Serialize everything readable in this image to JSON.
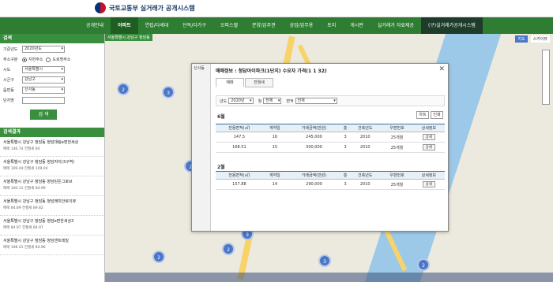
{
  "header": {
    "logo_text": "국토교통부 실거래가 공개시스템"
  },
  "nav": {
    "items": [
      {
        "label": "공개안내",
        "active": false
      },
      {
        "label": "아파트",
        "active": true
      },
      {
        "label": "연립/다세대",
        "active": false
      },
      {
        "label": "단독/다가구",
        "active": false
      },
      {
        "label": "오피스텔",
        "active": false
      },
      {
        "label": "분양/입주권",
        "active": false
      },
      {
        "label": "상업/업무용",
        "active": false
      },
      {
        "label": "토지",
        "active": false
      },
      {
        "label": "게시판",
        "active": false
      },
      {
        "label": "실거래가 자료제공",
        "active": false
      },
      {
        "label": "(구)실거래가공개시스템",
        "active": false
      }
    ]
  },
  "sidebar": {
    "search_title": "검색",
    "fields": {
      "period_label": "기준년도",
      "period_value": "2020년도",
      "type_label": "주소구분",
      "radio1": "지번주소",
      "radio2": "도로명주소",
      "city_label": "시도",
      "city_value": "서울특별시",
      "gu_label": "시군구",
      "gu_value": "강남구",
      "dong_label": "읍면동",
      "dong_value": "신사동",
      "name_label": "단지명"
    },
    "search_button": "검 색",
    "results_title": "검색결과",
    "results": [
      {
        "title": "서울특별시 강남구 청담동 청담대림e편한세상",
        "sub": "매매 146.74 전월세 84"
      },
      {
        "title": "서울특별시 강남구 청담동 청담자이(3구역)",
        "sub": "매매 109.44 전월세 109.04"
      },
      {
        "title": "서울특별시 강남구 청담동 청담린든그로브",
        "sub": "매매 100.11 전월세 84.99"
      },
      {
        "title": "서울특별시 강남구 청담동 청담래미안로이뷰",
        "sub": "매매 84.89 전월세 89.82"
      },
      {
        "title": "서울특별시 강남구 청담동 청담e편한세상3",
        "sub": "매매 84.97 전월세 84.97"
      },
      {
        "title": "서울특별시 강남구 청담동 청담센트레빌",
        "sub": "매매 108.41 전월세 84.96"
      }
    ]
  },
  "map": {
    "location_label": "서울특별시 강남구 청담동",
    "btn_map": "지도",
    "btn_sky": "스카이뷰",
    "clusters": [
      "2",
      "3",
      "2",
      "3",
      "2",
      "3",
      "2",
      "2"
    ]
  },
  "popup": {
    "side_label": "신사동",
    "title": "매매정보 : 청담아이파크(1단지) 수요자 가격(1 1 32)",
    "tab1": "매매",
    "tab2": "전월세",
    "filter": {
      "label1": "년도",
      "value1": "2020년",
      "label2": "월",
      "value2": "전체",
      "label3": "면적",
      "value3": "전체"
    },
    "section1": {
      "title": "6월",
      "btn1": "차트",
      "btn2": "인쇄",
      "headers": [
        "전용면적(㎡)",
        "계약일",
        "거래금액(만원)",
        "층",
        "건축년도",
        "우편번호",
        "상세정보"
      ],
      "rows": [
        [
          "147.5",
          "16",
          "245,000",
          "3",
          "2010",
          "25개월",
          "상세"
        ],
        [
          "168.51",
          "15",
          "300,000",
          "3",
          "2010",
          "25개월",
          "상세"
        ]
      ]
    },
    "section2": {
      "title": "2월",
      "headers": [
        "전용면적(㎡)",
        "계약일",
        "거래금액(만원)",
        "층",
        "건축년도",
        "우편번호",
        "상세정보"
      ],
      "rows": [
        [
          "157.88",
          "14",
          "290,000",
          "3",
          "2010",
          "25개월",
          "상세"
        ]
      ]
    }
  }
}
